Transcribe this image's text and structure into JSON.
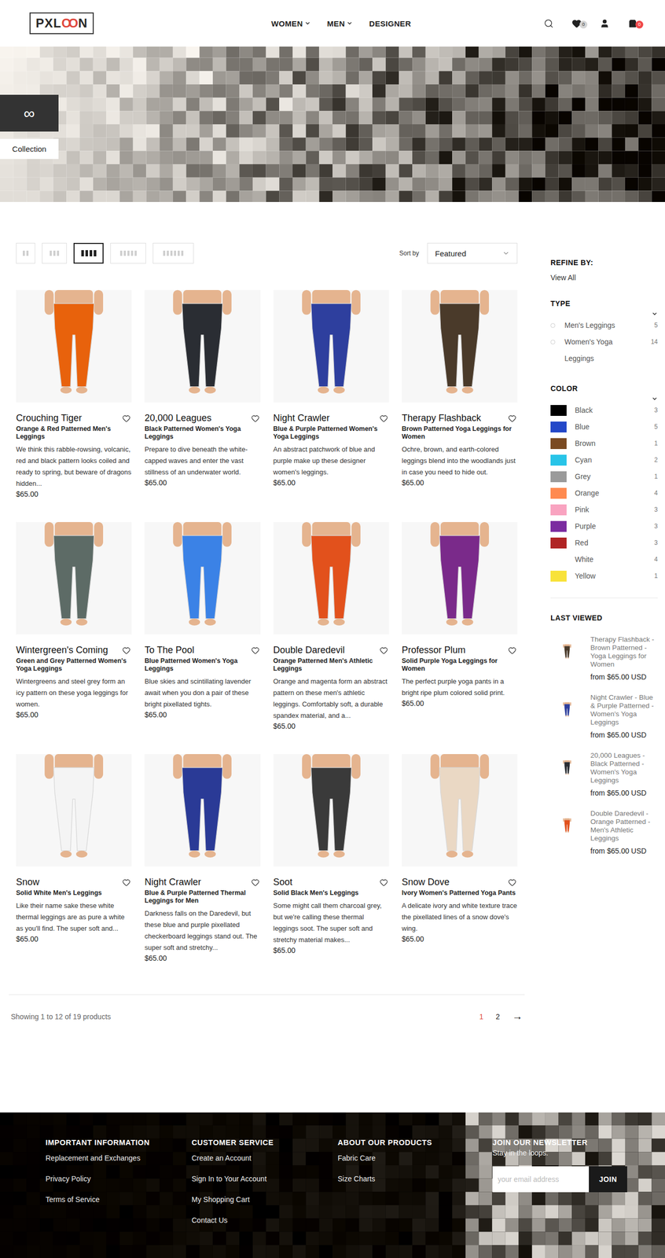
{
  "header": {
    "logo": {
      "prefix": "PXL",
      "mark": "OO",
      "suffix": "N"
    },
    "nav": [
      {
        "label": "WOMEN",
        "dropdown": true
      },
      {
        "label": "MEN",
        "dropdown": true
      },
      {
        "label": "DESIGNER",
        "dropdown": false
      }
    ],
    "wishlist_count": "0",
    "cart_count": "0"
  },
  "hero": {
    "badge": "∞",
    "label": "Collection"
  },
  "toolbar": {
    "views": [
      {
        "columns": 2,
        "selected": false
      },
      {
        "columns": 3,
        "selected": false
      },
      {
        "columns": 4,
        "selected": true
      },
      {
        "columns": 5,
        "selected": false
      },
      {
        "columns": 6,
        "selected": false
      }
    ],
    "sort_label": "Sort by",
    "sort_value": "Featured"
  },
  "products": [
    {
      "name": "Crouching Tiger",
      "subtitle": "Orange & Red Patterned Men's Leggings",
      "description": "We think this rabble-rowsing, volcanic, red and black pattern looks coiled and ready to spring, but beware of dragons hidden...",
      "price": "$65.00",
      "color": "#e8620c"
    },
    {
      "name": "20,000 Leagues",
      "subtitle": "Black Patterned Women's Yoga Leggings",
      "description": "Prepare to dive beneath the white-capped waves and enter the vast stillness of an underwater world.",
      "price": "$65.00",
      "color": "#2a2d33"
    },
    {
      "name": "Night Crawler",
      "subtitle": "Blue & Purple Patterned Women's Yoga Leggings",
      "description": "An abstract patchwork of blue and purple make up these designer women's leggings.",
      "price": "$65.00",
      "color": "#2e3f9e"
    },
    {
      "name": "Therapy Flashback",
      "subtitle": "Brown Patterned Yoga Leggings for Women",
      "description": "Ochre, brown, and earth-colored leggings blend into the woodlands just in case you need to hide out.",
      "price": "$65.00",
      "color": "#4a3a2a"
    },
    {
      "name": "Wintergreen's Coming",
      "subtitle": "Green and Grey Patterned Women's Yoga Leggings",
      "description": "Wintergreens and steel grey form an icy pattern on these yoga leggings for women.",
      "price": "$65.00",
      "color": "#5d6b66"
    },
    {
      "name": "To The Pool",
      "subtitle": "Blue Patterned Women's Yoga Leggings",
      "description": "Blue skies and scintillating lavender await when you don a pair of these bright pixellated tights.",
      "price": "$65.00",
      "color": "#3b82e6"
    },
    {
      "name": "Double Daredevil",
      "subtitle": "Orange Patterned Men's Athletic Leggings",
      "description": "Orange and magenta form an abstract pattern on these men's athletic leggings. Comfortably soft, a durable spandex material, and a...",
      "price": "$65.00",
      "color": "#e2511c"
    },
    {
      "name": "Professor Plum",
      "subtitle": "Solid Purple Yoga Leggings for Women",
      "description": "The perfect purple yoga pants in a bright ripe plum colored solid print.",
      "price": "$65.00",
      "color": "#7a2a8a"
    },
    {
      "name": "Snow",
      "subtitle": "Solid White Men's Leggings",
      "description": "Like their name sake these white thermal leggings are as pure a white as you'll find. The super soft and...",
      "price": "$65.00",
      "color": "#f4f4f4"
    },
    {
      "name": "Night Crawler",
      "subtitle": "Blue & Purple Patterned Thermal Leggings for Men",
      "description": "Darkness falls on the Daredevil, but these blue and purple pixellated checkerboard leggings stand out. The super soft and stretchy...",
      "price": "$65.00",
      "color": "#2a3a96"
    },
    {
      "name": "Soot",
      "subtitle": "Solid Black Men's Leggings",
      "description": "Some might call them charcoal grey, but we're calling these thermal leggings soot. The super soft and stretchy material makes...",
      "price": "$65.00",
      "color": "#3a3a3a"
    },
    {
      "name": "Snow Dove",
      "subtitle": "Ivory Women's Patterned Yoga Pants",
      "description": "A delicate ivory and white texture trace the pixellated lines of a snow dove's wing.",
      "price": "$65.00",
      "color": "#ead8c4"
    }
  ],
  "pagination": {
    "summary": "Showing 1 to 12 of 19 products",
    "pages": [
      {
        "label": "1",
        "selected": true
      },
      {
        "label": "2",
        "selected": false
      }
    ],
    "next": "→"
  },
  "sidebar": {
    "title": "REFINE BY:",
    "view_all": "View All",
    "type": {
      "title": "TYPE",
      "items": [
        {
          "label": "Men's Leggings",
          "count": "5",
          "selected": false
        },
        {
          "label": "Women's Yoga Leggings",
          "count": "14",
          "selected": false
        }
      ]
    },
    "color": {
      "title": "COLOR",
      "items": [
        {
          "label": "Black",
          "count": "3",
          "color": "#000000"
        },
        {
          "label": "Blue",
          "count": "5",
          "color": "#2448c8"
        },
        {
          "label": "Brown",
          "count": "1",
          "color": "#7a4a22"
        },
        {
          "label": "Cyan",
          "count": "2",
          "color": "#28c4e8"
        },
        {
          "label": "Grey",
          "count": "1",
          "color": "#9a9a9a"
        },
        {
          "label": "Orange",
          "count": "4",
          "color": "#ff8a50"
        },
        {
          "label": "Pink",
          "count": "3",
          "color": "#f9a3c0"
        },
        {
          "label": "Purple",
          "count": "3",
          "color": "#7b2ca0"
        },
        {
          "label": "Red",
          "count": "3",
          "color": "#b02424"
        },
        {
          "label": "White",
          "count": "4",
          "color": "#ffffff"
        },
        {
          "label": "Yellow",
          "count": "1",
          "color": "#f8e23a"
        }
      ]
    },
    "last_viewed": {
      "title": "LAST VIEWED",
      "items": [
        {
          "name": "Therapy Flashback - Brown Patterned - Yoga Leggings for Women",
          "price": "from $65.00 USD",
          "color": "#4a3a2a"
        },
        {
          "name": "Night Crawler - Blue & Purple Patterned - Women's Yoga Leggings",
          "price": "from $65.00 USD",
          "color": "#2e3f9e"
        },
        {
          "name": "20,000 Leagues - Black Patterned - Women's Yoga Leggings",
          "price": "from $65.00 USD",
          "color": "#2a2d33"
        },
        {
          "name": "Double Daredevil - Orange Patterned - Men's Athletic Leggings",
          "price": "from $65.00 USD",
          "color": "#e2511c"
        }
      ]
    }
  },
  "footer": {
    "columns": [
      {
        "title": "IMPORTANT INFORMATION",
        "links": [
          "Replacement and Exchanges",
          "Privacy Policy",
          "Terms of Service"
        ]
      },
      {
        "title": "CUSTOMER SERVICE",
        "links": [
          "Create an Account",
          "Sign In to Your Account",
          "My Shopping Cart",
          "Contact Us"
        ]
      },
      {
        "title": "ABOUT OUR PRODUCTS",
        "links": [
          "Fabric Care",
          "Size Charts"
        ]
      }
    ],
    "newsletter": {
      "title": "JOIN OUR NEWSLETTER",
      "subtitle": "Stay in the loops.",
      "placeholder": "your email address",
      "button": "JOIN"
    }
  }
}
